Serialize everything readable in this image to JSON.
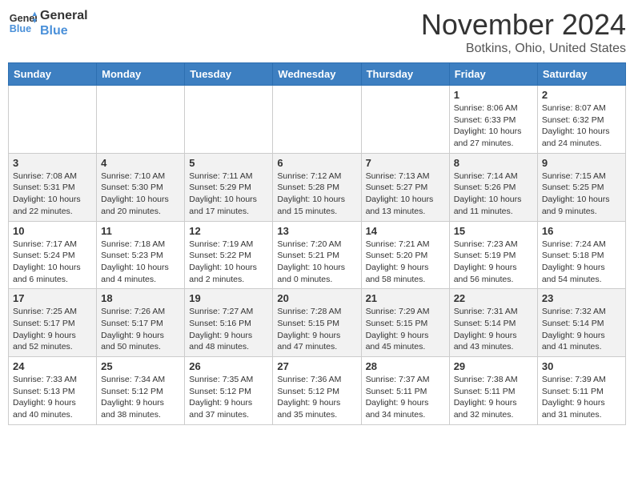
{
  "header": {
    "logo_line1": "General",
    "logo_line2": "Blue",
    "month": "November 2024",
    "location": "Botkins, Ohio, United States"
  },
  "weekdays": [
    "Sunday",
    "Monday",
    "Tuesday",
    "Wednesday",
    "Thursday",
    "Friday",
    "Saturday"
  ],
  "weeks": [
    [
      {
        "day": "",
        "info": ""
      },
      {
        "day": "",
        "info": ""
      },
      {
        "day": "",
        "info": ""
      },
      {
        "day": "",
        "info": ""
      },
      {
        "day": "",
        "info": ""
      },
      {
        "day": "1",
        "info": "Sunrise: 8:06 AM\nSunset: 6:33 PM\nDaylight: 10 hours and 27 minutes."
      },
      {
        "day": "2",
        "info": "Sunrise: 8:07 AM\nSunset: 6:32 PM\nDaylight: 10 hours and 24 minutes."
      }
    ],
    [
      {
        "day": "3",
        "info": "Sunrise: 7:08 AM\nSunset: 5:31 PM\nDaylight: 10 hours and 22 minutes."
      },
      {
        "day": "4",
        "info": "Sunrise: 7:10 AM\nSunset: 5:30 PM\nDaylight: 10 hours and 20 minutes."
      },
      {
        "day": "5",
        "info": "Sunrise: 7:11 AM\nSunset: 5:29 PM\nDaylight: 10 hours and 17 minutes."
      },
      {
        "day": "6",
        "info": "Sunrise: 7:12 AM\nSunset: 5:28 PM\nDaylight: 10 hours and 15 minutes."
      },
      {
        "day": "7",
        "info": "Sunrise: 7:13 AM\nSunset: 5:27 PM\nDaylight: 10 hours and 13 minutes."
      },
      {
        "day": "8",
        "info": "Sunrise: 7:14 AM\nSunset: 5:26 PM\nDaylight: 10 hours and 11 minutes."
      },
      {
        "day": "9",
        "info": "Sunrise: 7:15 AM\nSunset: 5:25 PM\nDaylight: 10 hours and 9 minutes."
      }
    ],
    [
      {
        "day": "10",
        "info": "Sunrise: 7:17 AM\nSunset: 5:24 PM\nDaylight: 10 hours and 6 minutes."
      },
      {
        "day": "11",
        "info": "Sunrise: 7:18 AM\nSunset: 5:23 PM\nDaylight: 10 hours and 4 minutes."
      },
      {
        "day": "12",
        "info": "Sunrise: 7:19 AM\nSunset: 5:22 PM\nDaylight: 10 hours and 2 minutes."
      },
      {
        "day": "13",
        "info": "Sunrise: 7:20 AM\nSunset: 5:21 PM\nDaylight: 10 hours and 0 minutes."
      },
      {
        "day": "14",
        "info": "Sunrise: 7:21 AM\nSunset: 5:20 PM\nDaylight: 9 hours and 58 minutes."
      },
      {
        "day": "15",
        "info": "Sunrise: 7:23 AM\nSunset: 5:19 PM\nDaylight: 9 hours and 56 minutes."
      },
      {
        "day": "16",
        "info": "Sunrise: 7:24 AM\nSunset: 5:18 PM\nDaylight: 9 hours and 54 minutes."
      }
    ],
    [
      {
        "day": "17",
        "info": "Sunrise: 7:25 AM\nSunset: 5:17 PM\nDaylight: 9 hours and 52 minutes."
      },
      {
        "day": "18",
        "info": "Sunrise: 7:26 AM\nSunset: 5:17 PM\nDaylight: 9 hours and 50 minutes."
      },
      {
        "day": "19",
        "info": "Sunrise: 7:27 AM\nSunset: 5:16 PM\nDaylight: 9 hours and 48 minutes."
      },
      {
        "day": "20",
        "info": "Sunrise: 7:28 AM\nSunset: 5:15 PM\nDaylight: 9 hours and 47 minutes."
      },
      {
        "day": "21",
        "info": "Sunrise: 7:29 AM\nSunset: 5:15 PM\nDaylight: 9 hours and 45 minutes."
      },
      {
        "day": "22",
        "info": "Sunrise: 7:31 AM\nSunset: 5:14 PM\nDaylight: 9 hours and 43 minutes."
      },
      {
        "day": "23",
        "info": "Sunrise: 7:32 AM\nSunset: 5:14 PM\nDaylight: 9 hours and 41 minutes."
      }
    ],
    [
      {
        "day": "24",
        "info": "Sunrise: 7:33 AM\nSunset: 5:13 PM\nDaylight: 9 hours and 40 minutes."
      },
      {
        "day": "25",
        "info": "Sunrise: 7:34 AM\nSunset: 5:12 PM\nDaylight: 9 hours and 38 minutes."
      },
      {
        "day": "26",
        "info": "Sunrise: 7:35 AM\nSunset: 5:12 PM\nDaylight: 9 hours and 37 minutes."
      },
      {
        "day": "27",
        "info": "Sunrise: 7:36 AM\nSunset: 5:12 PM\nDaylight: 9 hours and 35 minutes."
      },
      {
        "day": "28",
        "info": "Sunrise: 7:37 AM\nSunset: 5:11 PM\nDaylight: 9 hours and 34 minutes."
      },
      {
        "day": "29",
        "info": "Sunrise: 7:38 AM\nSunset: 5:11 PM\nDaylight: 9 hours and 32 minutes."
      },
      {
        "day": "30",
        "info": "Sunrise: 7:39 AM\nSunset: 5:11 PM\nDaylight: 9 hours and 31 minutes."
      }
    ]
  ]
}
